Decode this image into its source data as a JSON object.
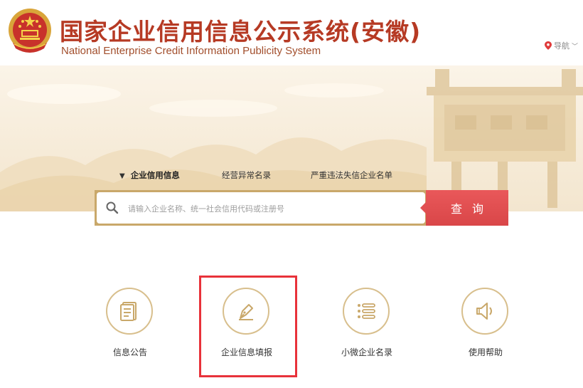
{
  "header": {
    "title_cn": "国家企业信用信息公示系统(安徽)",
    "title_en": "National Enterprise Credit Information Publicity System",
    "nav_label": "导航",
    "nav_chevron": "﹀"
  },
  "search": {
    "tabs": [
      {
        "label": "企业信用信息",
        "active": true
      },
      {
        "label": "经营异常名录",
        "active": false
      },
      {
        "label": "严重违法失信企业名单",
        "active": false
      }
    ],
    "active_marker": "▼",
    "placeholder": "请输入企业名称、统一社会信用代码或注册号",
    "button_label": "查询"
  },
  "features": [
    {
      "label": "信息公告",
      "icon": "document-icon"
    },
    {
      "label": "企业信息填报",
      "icon": "pen-nib-icon",
      "highlighted": true
    },
    {
      "label": "小微企业名录",
      "icon": "list-icon"
    },
    {
      "label": "使用帮助",
      "icon": "speaker-icon"
    }
  ],
  "colors": {
    "title_red": "#b63a24",
    "search_button": "#e15052",
    "gold_border": "#d8bf8d",
    "highlight_red": "#e8323a"
  }
}
